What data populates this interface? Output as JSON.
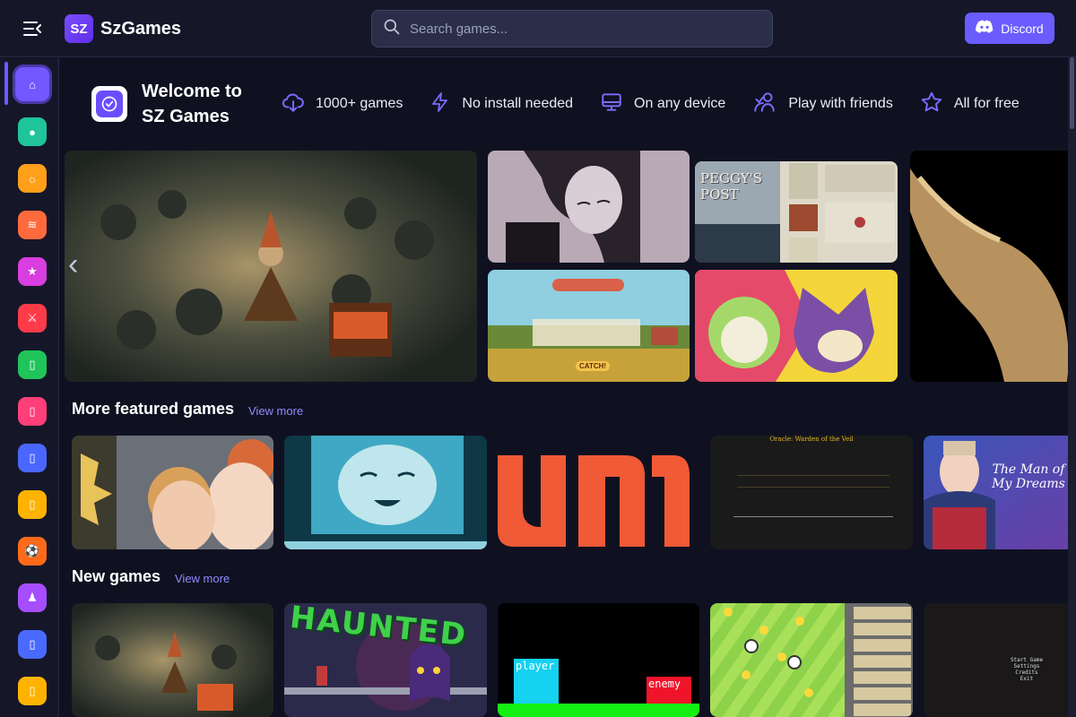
{
  "app": {
    "name": "SzGames",
    "logo_mark": "SZ"
  },
  "search": {
    "placeholder": "Search games..."
  },
  "discord": {
    "label": "Discord"
  },
  "sidebar": {
    "items": [
      {
        "icon": "home-icon",
        "color": "#7357ff",
        "glyph": "⌂"
      },
      {
        "icon": "circle-icon",
        "color": "#1fc49a",
        "glyph": "●"
      },
      {
        "icon": "sun-icon",
        "color": "#ff9f1a",
        "glyph": "☼"
      },
      {
        "icon": "zigzag-icon",
        "color": "#ff6a3d",
        "glyph": "≋"
      },
      {
        "icon": "star-icon",
        "color": "#d83ee0",
        "glyph": "★"
      },
      {
        "icon": "swords-icon",
        "color": "#ff3b4a",
        "glyph": "⚔"
      },
      {
        "icon": "puzzle-icon",
        "color": "#20c45a",
        "glyph": "▯"
      },
      {
        "icon": "heart-icon",
        "color": "#ff3f7a",
        "glyph": "▯"
      },
      {
        "icon": "cube-icon",
        "color": "#4a66ff",
        "glyph": "▯"
      },
      {
        "icon": "crown-icon",
        "color": "#ffb300",
        "glyph": "▯"
      },
      {
        "icon": "ball-icon",
        "color": "#ff6a1a",
        "glyph": "⚽"
      },
      {
        "icon": "pawn-icon",
        "color": "#a64dff",
        "glyph": "♟"
      },
      {
        "icon": "shield-icon",
        "color": "#4a6aff",
        "glyph": "▯"
      },
      {
        "icon": "trophy-icon",
        "color": "#ffb300",
        "glyph": "▯"
      }
    ]
  },
  "welcome": {
    "title": "Welcome to SZ Games",
    "features": [
      {
        "icon": "download-icon",
        "label": "1000+ games"
      },
      {
        "icon": "bolt-icon",
        "label": "No install needed"
      },
      {
        "icon": "monitor-icon",
        "label": "On any device"
      },
      {
        "icon": "friends-icon",
        "label": "Play with friends"
      },
      {
        "icon": "star-outline-icon",
        "label": "All for free"
      }
    ]
  },
  "featured": {
    "tiles": [
      {
        "name": "featured-hero-dwarf-game"
      },
      {
        "name": "featured-crying-girl-game"
      },
      {
        "name": "featured-peggys-post-game",
        "text": "PEGGY'S POST"
      },
      {
        "name": "featured-farm-catch-game",
        "text": "CATCH!"
      },
      {
        "name": "featured-cat-battle-game"
      },
      {
        "name": "featured-golden-statue-game"
      }
    ]
  },
  "more_featured": {
    "title": "More featured games",
    "view_more": "View more",
    "tiles": [
      {
        "name": "game-anime-dungeon"
      },
      {
        "name": "game-pixel-girl"
      },
      {
        "name": "game-um-logo",
        "text": "um"
      },
      {
        "name": "game-dark-text",
        "text": "Oracle: Warden of the Veil"
      },
      {
        "name": "game-man-of-my-dreams",
        "text": "The Man of My Dreams"
      }
    ]
  },
  "new_games": {
    "title": "New games",
    "view_more": "View more",
    "tiles": [
      {
        "name": "game-dwarf-goblins"
      },
      {
        "name": "game-haunted",
        "text": "HAUNTED"
      },
      {
        "name": "game-player-enemy",
        "text_a": "player",
        "text_b": "enemy"
      },
      {
        "name": "game-coin-field"
      },
      {
        "name": "game-start-menu",
        "lines": [
          "Start Game",
          "Settings",
          "Credits",
          "Exit"
        ]
      }
    ]
  },
  "colors": {
    "accent": "#6a5cff",
    "bg": "#0f1121",
    "panel": "#151729"
  }
}
